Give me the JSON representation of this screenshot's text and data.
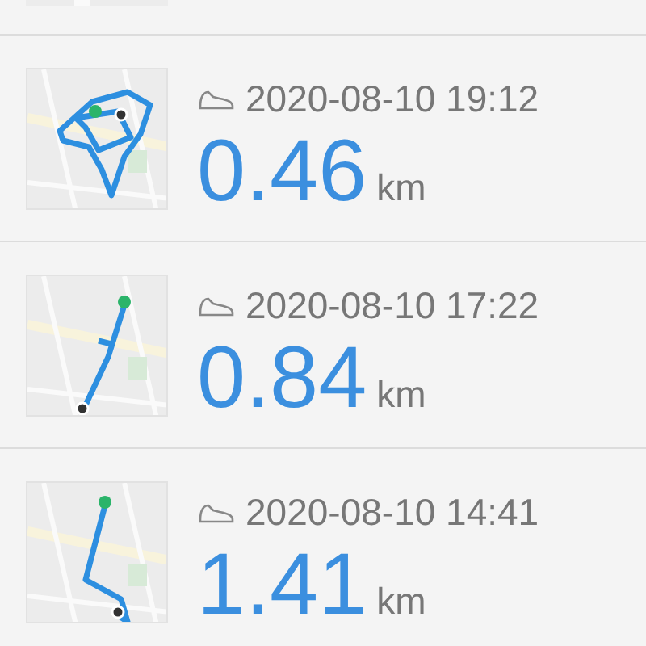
{
  "activities": [
    {
      "date": "2020-08-10 19:12",
      "distance": "0.46",
      "unit": "km"
    },
    {
      "date": "2020-08-10 17:22",
      "distance": "0.84",
      "unit": "km"
    },
    {
      "date": "2020-08-10 14:41",
      "distance": "1.41",
      "unit": "km"
    }
  ]
}
